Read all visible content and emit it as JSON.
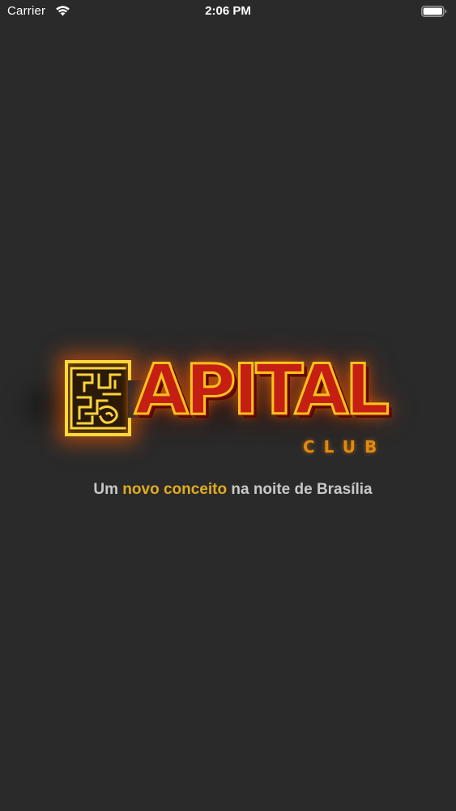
{
  "status_bar": {
    "carrier": "Carrier",
    "time": "2:06 PM",
    "wifi_icon": "wifi-icon",
    "battery_icon": "battery-icon",
    "battery_level": 1.0
  },
  "splash": {
    "logo": {
      "word": "APITAL",
      "subword": "CLUB",
      "emblem_icon": "maze-emblem-c-icon"
    },
    "tagline": {
      "part1": "Um ",
      "highlight": "novo conceito",
      "part2": " na noite de Brasília"
    }
  },
  "colors": {
    "background": "#2a2a2a",
    "logo_red": "#c51f14",
    "logo_gold": "#ffc21a",
    "club_orange": "#e08a10",
    "tagline_text": "#c8c8c8",
    "tagline_highlight": "#e2ac1e"
  }
}
